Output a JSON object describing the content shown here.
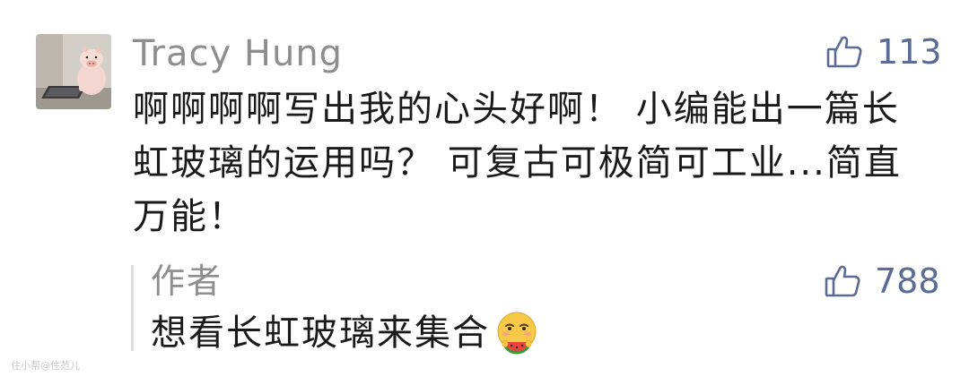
{
  "comment": {
    "avatar_icon": "pig-at-laptop-avatar",
    "username": "Tracy Hung",
    "like_icon": "thumbs-up-icon",
    "like_count": "113",
    "text_lines": [
      "啊啊啊啊写出我的心头好啊！ 小编能出一篇长",
      "虹玻璃的运用吗？ 可复古可极简可工业...简直",
      "万能！"
    ]
  },
  "reply": {
    "author": "作者",
    "like_icon": "thumbs-up-icon",
    "like_count": "788",
    "text": "想看长虹玻璃来集合",
    "emoji": "eating-watermelon-emoji"
  },
  "watermark": "住小帮@住范儿",
  "colors": {
    "username": "#8e8e8e",
    "like_accent": "#5b6b94",
    "body_text": "#1a1a1a",
    "reply_bar": "#dcdcdc"
  }
}
